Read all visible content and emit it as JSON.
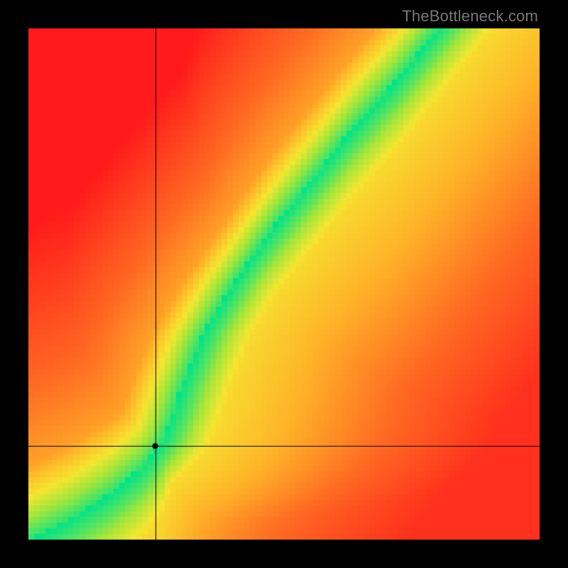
{
  "watermark": "TheBottleneck.com",
  "chart_data": {
    "type": "heatmap",
    "title": "",
    "xlabel": "",
    "ylabel": "",
    "xlim": [
      0,
      1
    ],
    "ylim": [
      0,
      1
    ],
    "grid": false,
    "legend": false,
    "note": "Heatmap colored by distance from an optimal curve. Green = on the curve (low bottleneck), yellow = near, red = far. A crosshair marks a single (x, y) point.",
    "colorscale": [
      {
        "t": 0.0,
        "hex": "#00e38a"
      },
      {
        "t": 0.18,
        "hex": "#a6e63a"
      },
      {
        "t": 0.32,
        "hex": "#f6e631"
      },
      {
        "t": 0.5,
        "hex": "#ffb429"
      },
      {
        "t": 0.7,
        "hex": "#ff6a23"
      },
      {
        "t": 1.0,
        "hex": "#ff1b1b"
      }
    ],
    "curve": {
      "comment": "Piecewise-defined optimal ridge y = f(x) in normalized [0,1] coords (y measured from bottom).",
      "points": [
        {
          "x": 0.0,
          "y": 0.0
        },
        {
          "x": 0.08,
          "y": 0.04
        },
        {
          "x": 0.16,
          "y": 0.09
        },
        {
          "x": 0.22,
          "y": 0.14
        },
        {
          "x": 0.26,
          "y": 0.19
        },
        {
          "x": 0.28,
          "y": 0.24
        },
        {
          "x": 0.3,
          "y": 0.3
        },
        {
          "x": 0.34,
          "y": 0.4
        },
        {
          "x": 0.4,
          "y": 0.5
        },
        {
          "x": 0.47,
          "y": 0.6
        },
        {
          "x": 0.55,
          "y": 0.7
        },
        {
          "x": 0.63,
          "y": 0.8
        },
        {
          "x": 0.72,
          "y": 0.9
        },
        {
          "x": 0.8,
          "y": 1.0
        }
      ],
      "green_halfwidth_x": 0.035,
      "yellow_halfwidth_x": 0.1
    },
    "crosshair": {
      "x": 0.248,
      "y": 0.183
    },
    "pixelation": 8
  }
}
